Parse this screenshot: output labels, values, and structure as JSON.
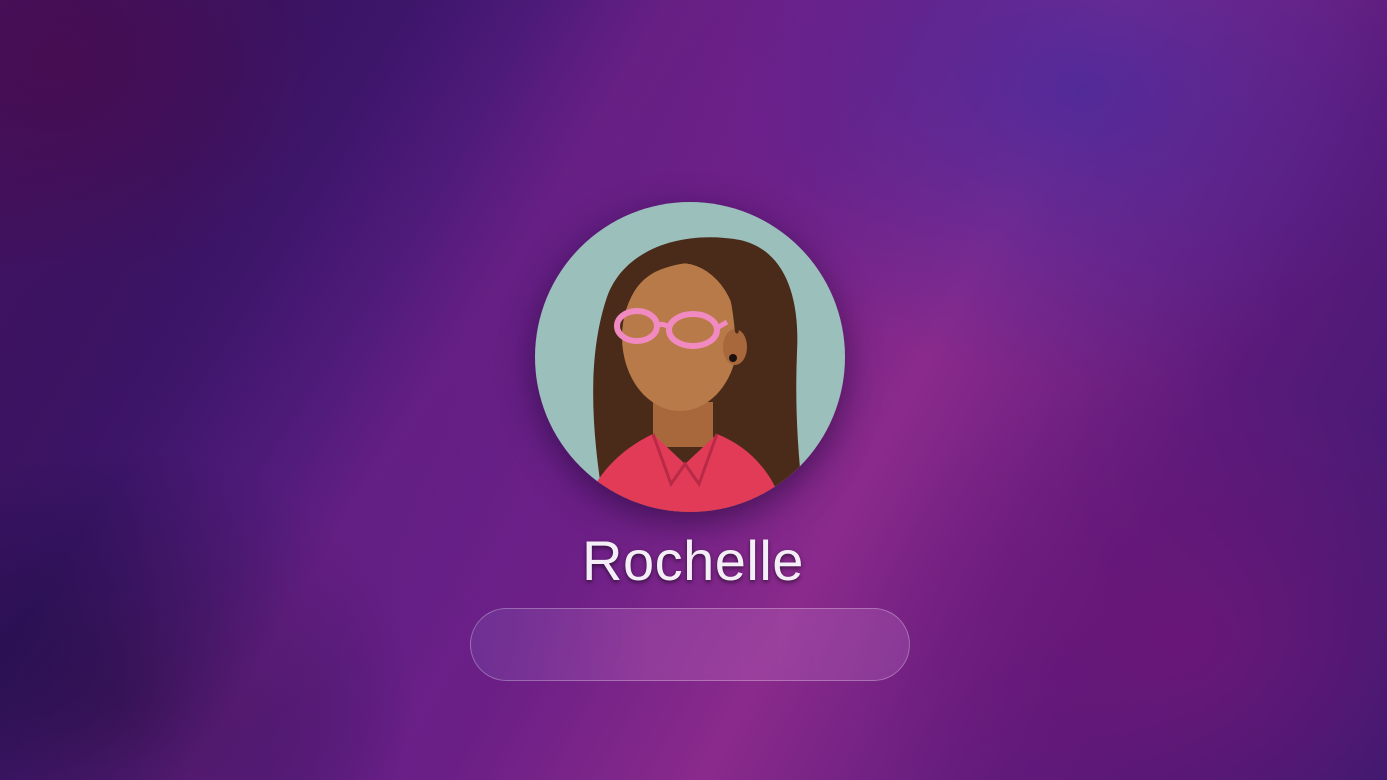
{
  "login": {
    "user_name": "Rochelle",
    "password_value": "",
    "password_placeholder": ""
  },
  "avatar": {
    "icon": "memoji-avatar",
    "colors": {
      "background": "#9bbfbb",
      "hair": "#4a2b1a",
      "skin": "#b97a49",
      "glasses": "#f08ac0",
      "shirt": "#e23b58"
    }
  }
}
